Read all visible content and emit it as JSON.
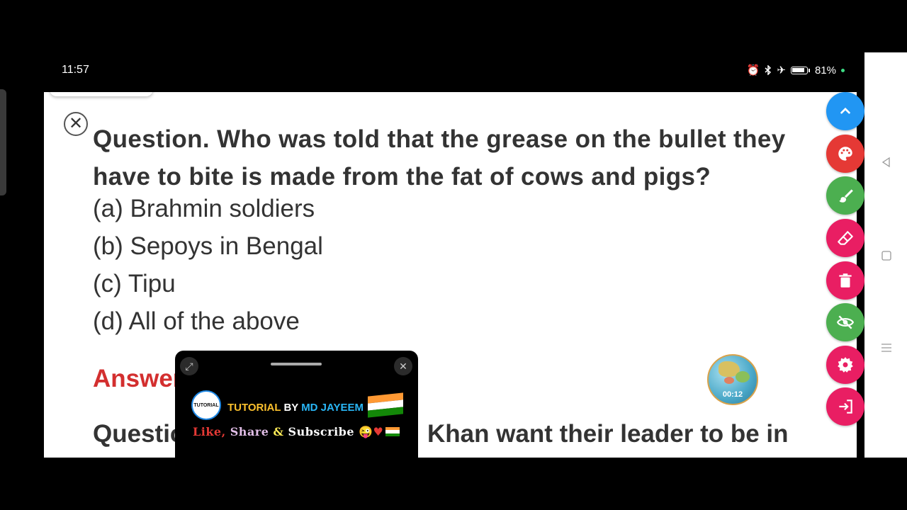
{
  "status_bar": {
    "time": "11:57",
    "battery_text": "81%"
  },
  "document": {
    "question": "Question. Who was told that the grease on the bullet they have to bite is made from the fat of cows and pigs?",
    "options": [
      "(a) Brahmin soldiers",
      "(b) Sepoys in Bengal",
      "(c) Tipu",
      "(d) All of the above"
    ],
    "answer_partial": "Answer",
    "next_question_left": "Questio",
    "next_question_right": "Khan want their leader to be in"
  },
  "recording_bubble": {
    "timer": "00:12"
  },
  "overlay": {
    "logo_text": "TUTORIAL",
    "channel_part1": "TUTORIAL",
    "channel_part2": " BY ",
    "channel_part3": "MD JAYEEM",
    "like": "Like,",
    "share": "Share",
    "amp": "&",
    "subscribe": "Subscribe",
    "emoji": "😜",
    "heart": "♥"
  },
  "toolbar": {
    "buttons": [
      {
        "name": "scroll-up",
        "color": "#2196f3",
        "icon": "chevron-up-icon"
      },
      {
        "name": "palette",
        "color": "#e53935",
        "icon": "palette-icon"
      },
      {
        "name": "brush",
        "color": "#4caf50",
        "icon": "brush-icon"
      },
      {
        "name": "eraser",
        "color": "#e91e63",
        "icon": "eraser-icon"
      },
      {
        "name": "delete",
        "color": "#e91e63",
        "icon": "trash-icon"
      },
      {
        "name": "visibility",
        "color": "#4caf50",
        "icon": "eye-off-icon"
      },
      {
        "name": "settings",
        "color": "#e91e63",
        "icon": "gear-icon"
      },
      {
        "name": "exit",
        "color": "#e91e63",
        "icon": "exit-icon"
      }
    ]
  }
}
